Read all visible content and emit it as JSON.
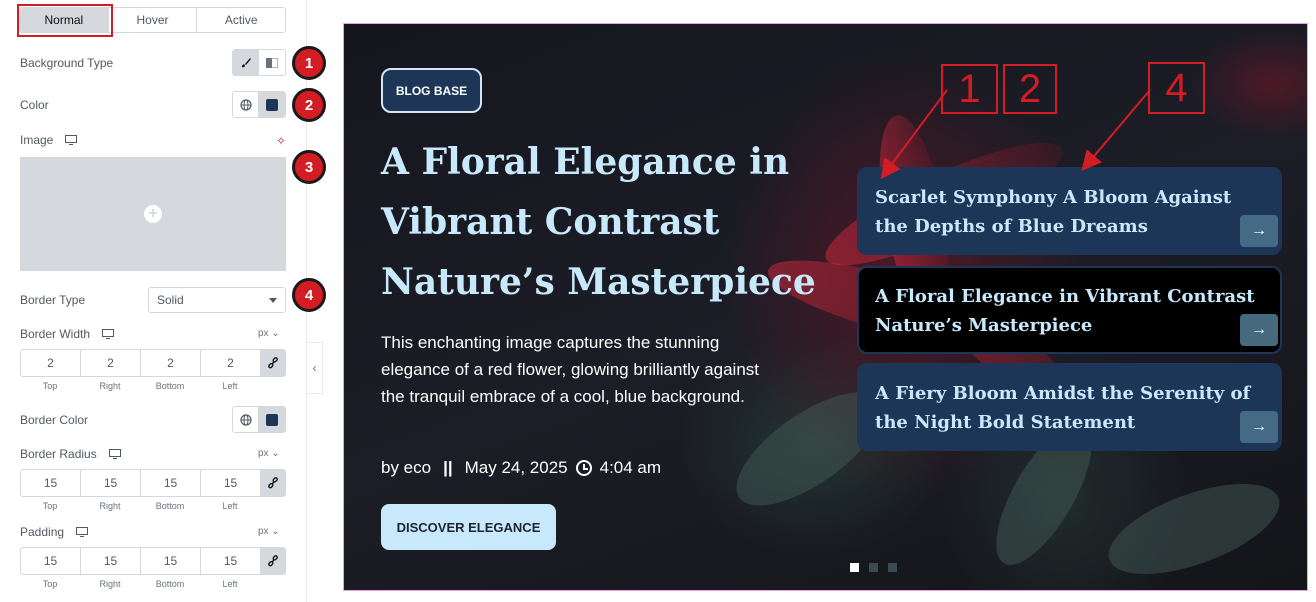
{
  "panel": {
    "tabs": [
      {
        "label": "Normal",
        "active": true
      },
      {
        "label": "Hover",
        "active": false
      },
      {
        "label": "Active",
        "active": false
      }
    ],
    "background_type_label": "Background Type",
    "color_label": "Color",
    "image_label": "Image",
    "border_type_label": "Border Type",
    "border_type_value": "Solid",
    "border_width_label": "Border Width",
    "border_width_unit": "px",
    "border_width_values": {
      "top": "2",
      "right": "2",
      "bottom": "2",
      "left": "2"
    },
    "border_color_label": "Border Color",
    "border_radius_label": "Border Radius",
    "border_radius_unit": "px",
    "border_radius_values": {
      "top": "15",
      "right": "15",
      "bottom": "15",
      "left": "15"
    },
    "padding_label": "Padding",
    "padding_unit": "px",
    "padding_values": {
      "top": "15",
      "right": "15",
      "bottom": "15",
      "left": "15"
    },
    "dim_labels": {
      "top": "Top",
      "right": "Right",
      "bottom": "Bottom",
      "left": "Left"
    },
    "swatch_color": "#1d3557",
    "badges": [
      "1",
      "2",
      "3",
      "4"
    ]
  },
  "hero": {
    "badge": "BLOG BASE",
    "title": "A Floral Elegance in Vibrant Contrast Nature’s Masterpiece",
    "description": "This enchanting image captures the stunning elegance of a red flower, glowing brilliantly against the tranquil embrace of a cool, blue background.",
    "author": "by eco",
    "date": "May 24, 2025",
    "time": "4:04 am",
    "cta": "DISCOVER ELEGANCE"
  },
  "cards": [
    {
      "title": "Scarlet Symphony A Bloom Against the Depths of Blue Dreams"
    },
    {
      "title": "A Floral Elegance in Vibrant Contrast Nature’s Masterpiece"
    },
    {
      "title": "A Fiery Bloom Amidst the Serenity of the Night Bold Statement"
    }
  ],
  "annotations": [
    "1",
    "2",
    "4"
  ],
  "colors": {
    "accent_red": "#d41c24",
    "navy": "#1d3557",
    "light_blue": "#c8e8fb"
  }
}
